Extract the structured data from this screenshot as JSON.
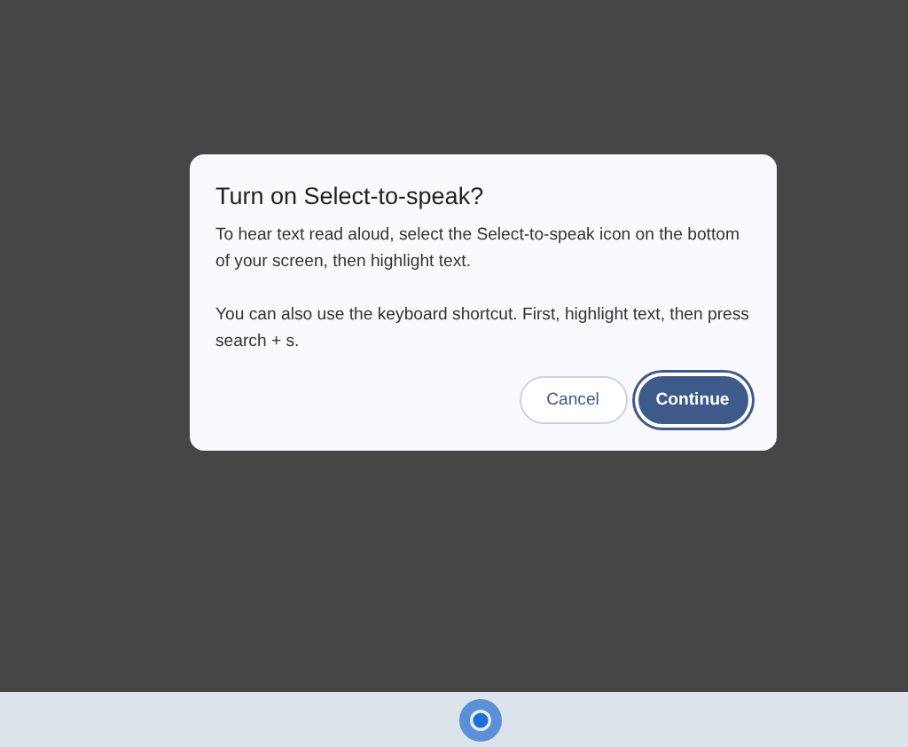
{
  "dialog": {
    "title": "Turn on Select-to-speak?",
    "paragraphs": [
      "To hear text read aloud, select the Select-to-speak icon on the bottom of your screen, then highlight text.",
      "You can also use the keyboard shortcut. First, highlight text, then press search + s."
    ],
    "buttons": [
      {
        "label": "Cancel",
        "kind": "secondary"
      },
      {
        "label": "Continue",
        "kind": "primary"
      }
    ]
  }
}
